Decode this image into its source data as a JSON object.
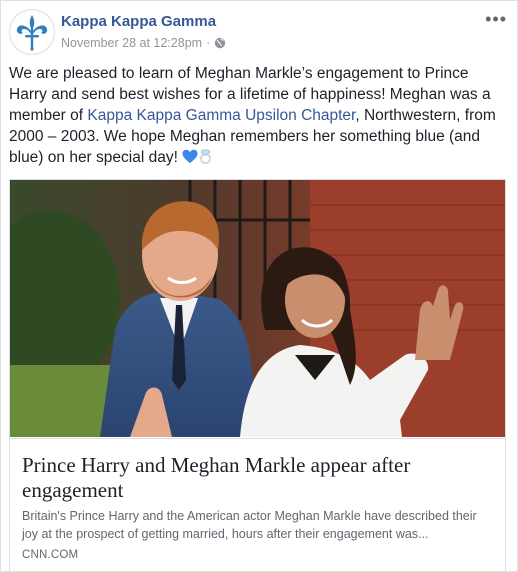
{
  "post": {
    "page_name": "Kappa Kappa Gamma",
    "timestamp": "November 28 at 12:28pm",
    "separator": "·",
    "more_label": "•••",
    "text_part1": "We are pleased to learn of Meghan Markle’s engagement to Prince Harry and send best wishes for a lifetime of happiness! Meghan was a member of ",
    "text_link": "Kappa Kappa Gamma Upsilon Chapter",
    "text_part2": ", Northwestern, from 2000 – 2003. We hope Meghan remembers her something blue (and blue) on her special day!",
    "emoji_icons": [
      "blue-heart-icon",
      "ring-icon"
    ]
  },
  "card": {
    "title": "Prince Harry and Meghan Markle appear after engagement",
    "description": "Britain's Prince Harry and the American actor Meghan Markle have described their joy at the prospect of getting married, hours after their engagement was...",
    "domain": "CNN.COM"
  },
  "colors": {
    "link": "#365899",
    "meta": "#90949c",
    "logo": "#2f7fc1"
  }
}
